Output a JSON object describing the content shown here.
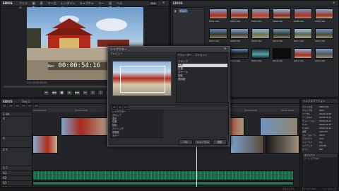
{
  "app": {
    "title": "EDIUS",
    "player_label": "PLR",
    "recorder_label": "REC"
  },
  "menu": {
    "items": [
      "ファイル",
      "編集",
      "表示",
      "マーカー",
      "レンダリング",
      "キャプチャー",
      "ツール",
      "設定",
      "ヘルプ"
    ]
  },
  "player": {
    "timecode_prefix": "Rec",
    "timecode": "00:00:54:16",
    "cur_label": "Cur 00:00:54:16",
    "in_out": "In --:--:--:--  Out --:--:--:--  Dur --:--:--:--"
  },
  "bin": {
    "title": "EDIUS",
    "folder": "Root",
    "clips": [
      "0001.mts",
      "0002.mts",
      "0003.mts",
      "0004.mts",
      "0005.mts",
      "0006.mts",
      "0007.mts",
      "0008.mts",
      "0009.mts",
      "0010.mts",
      "0011.mts",
      "0012.mts",
      "0013.mts",
      "0014.mts",
      "0015.mts",
      "0016.mts",
      "0017.mts",
      "0018.mts"
    ]
  },
  "layouter": {
    "title": "レイアウター",
    "tab_preview": "プレビュー",
    "tab_params": "パラメーター",
    "tab_presets": "プリセット",
    "param_items": [
      "クロップ",
      "変形",
      "位置",
      "スケール",
      "回転",
      "透明度"
    ],
    "track_rows": [
      "レイアウター",
      "クロップ",
      "変形",
      "位置",
      "回転",
      "ストレッチ",
      "透明度",
      "カラー"
    ],
    "ok": "OK",
    "cancel": "キャンセル",
    "apply": "適用"
  },
  "timeline": {
    "title": "EDIUS",
    "sequence": "Seq 1",
    "ruler": [
      "00:00:00;00",
      "00:00:10;00",
      "00:00:20;00",
      "00:00:30;00",
      "00:00:40;00",
      "00:00:50;00",
      "00:01:00;00"
    ],
    "tracks": [
      "1 VA",
      "V",
      "A",
      "2 V",
      "1 T",
      "A1",
      "A2",
      "A3",
      "A4"
    ]
  },
  "info": {
    "title": "インフォメーション",
    "rows": [
      [
        "ファイル名",
        "0003.mts"
      ],
      [
        "クリップ名",
        "0003"
      ],
      [
        "ソースIn",
        "00:00:12;08"
      ],
      [
        "ソースOut",
        "00:00:31;22"
      ],
      [
        "デュレーション",
        "00:00:19;14"
      ],
      [
        "TL In",
        "00:00:32;10"
      ],
      [
        "TL Out",
        "00:00:51;24"
      ],
      [
        "速度",
        "100.00%"
      ],
      [
        "フレームレート",
        "29.97"
      ],
      [
        "アスペクト",
        "16:9"
      ],
      [
        "フィールド",
        "Top"
      ],
      [
        "コーデック",
        "AVCHD"
      ],
      [
        "ビット",
        "8bit"
      ]
    ],
    "effects_header": "エフェクト",
    "effect_item": "レイアウター"
  },
  "status": {
    "items": [
      "プロジェクト",
      "ディスク: 82%",
      "ハードウェア"
    ]
  }
}
